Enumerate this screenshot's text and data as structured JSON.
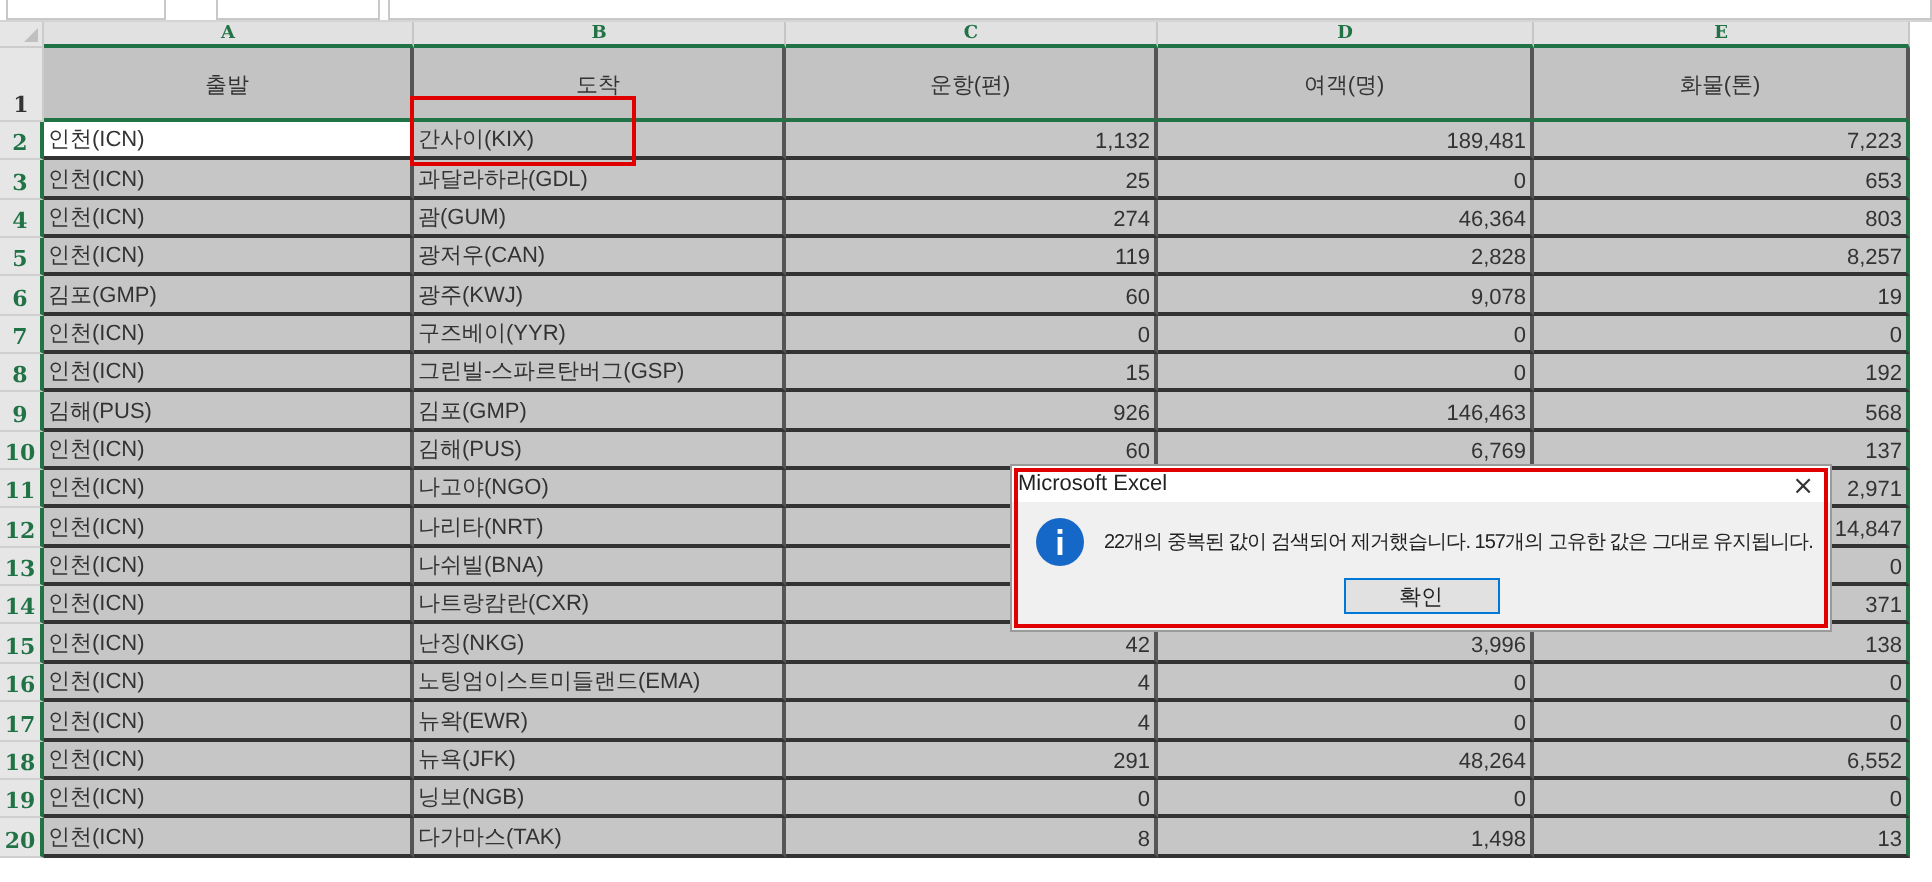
{
  "columns": [
    {
      "letter": "A",
      "selected": true
    },
    {
      "letter": "B",
      "selected": true
    },
    {
      "letter": "C",
      "selected": true
    },
    {
      "letter": "D",
      "selected": true
    },
    {
      "letter": "E",
      "selected": true
    }
  ],
  "header": {
    "number": "1",
    "selected": false,
    "cells": [
      "출발",
      "도착",
      "운항(편)",
      "여객(명)",
      "화물(톤)"
    ]
  },
  "rows": [
    {
      "number": "2",
      "selected": true,
      "active": true,
      "highlighted": true,
      "cells": [
        "인천(ICN)",
        "간사이(KIX)",
        "1,132",
        "189,481",
        "7,223"
      ]
    },
    {
      "number": "3",
      "selected": true,
      "active": false,
      "highlighted": false,
      "cells": [
        "인천(ICN)",
        "과달라하라(GDL)",
        "25",
        "0",
        "653"
      ]
    },
    {
      "number": "4",
      "selected": true,
      "active": false,
      "highlighted": false,
      "cells": [
        "인천(ICN)",
        "괌(GUM)",
        "274",
        "46,364",
        "803"
      ]
    },
    {
      "number": "5",
      "selected": true,
      "active": false,
      "highlighted": false,
      "cells": [
        "인천(ICN)",
        "광저우(CAN)",
        "119",
        "2,828",
        "8,257"
      ]
    },
    {
      "number": "6",
      "selected": true,
      "active": false,
      "highlighted": false,
      "cells": [
        "김포(GMP)",
        "광주(KWJ)",
        "60",
        "9,078",
        "19"
      ]
    },
    {
      "number": "7",
      "selected": true,
      "active": false,
      "highlighted": false,
      "cells": [
        "인천(ICN)",
        "구즈베이(YYR)",
        "0",
        "0",
        "0"
      ]
    },
    {
      "number": "8",
      "selected": true,
      "active": false,
      "highlighted": false,
      "cells": [
        "인천(ICN)",
        "그린빌-스파르탄버그(GSP)",
        "15",
        "0",
        "192"
      ]
    },
    {
      "number": "9",
      "selected": true,
      "active": false,
      "highlighted": false,
      "cells": [
        "김해(PUS)",
        "김포(GMP)",
        "926",
        "146,463",
        "568"
      ]
    },
    {
      "number": "10",
      "selected": true,
      "active": false,
      "highlighted": false,
      "cells": [
        "인천(ICN)",
        "김해(PUS)",
        "60",
        "6,769",
        "137"
      ]
    },
    {
      "number": "11",
      "selected": true,
      "active": false,
      "highlighted": false,
      "cells": [
        "인천(ICN)",
        "나고야(NGO)",
        null,
        null,
        "2,971"
      ]
    },
    {
      "number": "12",
      "selected": true,
      "active": false,
      "highlighted": false,
      "cells": [
        "인천(ICN)",
        "나리타(NRT)",
        null,
        null,
        "14,847"
      ]
    },
    {
      "number": "13",
      "selected": true,
      "active": false,
      "highlighted": false,
      "cells": [
        "인천(ICN)",
        "나쉬빌(BNA)",
        null,
        null,
        "0"
      ]
    },
    {
      "number": "14",
      "selected": true,
      "active": false,
      "highlighted": false,
      "cells": [
        "인천(ICN)",
        "나트랑캄란(CXR)",
        null,
        null,
        "371"
      ]
    },
    {
      "number": "15",
      "selected": true,
      "active": false,
      "highlighted": false,
      "cells": [
        "인천(ICN)",
        "난징(NKG)",
        "42",
        "3,996",
        "138"
      ]
    },
    {
      "number": "16",
      "selected": true,
      "active": false,
      "highlighted": false,
      "cells": [
        "인천(ICN)",
        "노팅엄이스트미들랜드(EMA)",
        "4",
        "0",
        "0"
      ]
    },
    {
      "number": "17",
      "selected": true,
      "active": false,
      "highlighted": false,
      "cells": [
        "인천(ICN)",
        "뉴왁(EWR)",
        "4",
        "0",
        "0"
      ]
    },
    {
      "number": "18",
      "selected": true,
      "active": false,
      "highlighted": false,
      "cells": [
        "인천(ICN)",
        "뉴욕(JFK)",
        "291",
        "48,264",
        "6,552"
      ]
    },
    {
      "number": "19",
      "selected": true,
      "active": false,
      "highlighted": false,
      "cells": [
        "인천(ICN)",
        "닝보(NGB)",
        "0",
        "0",
        "0"
      ]
    },
    {
      "number": "20",
      "selected": true,
      "active": false,
      "highlighted": false,
      "cells": [
        "인천(ICN)",
        "다가마스(TAK)",
        "8",
        "1,498",
        "13"
      ]
    }
  ],
  "dialog": {
    "title": "Microsoft Excel",
    "close": "×",
    "message": "22개의 중복된 값이 검색되어 제거했습니다. 157개의 고유한 값은 그대로 유지됩니다.",
    "button": "확인",
    "highlighted": true
  }
}
